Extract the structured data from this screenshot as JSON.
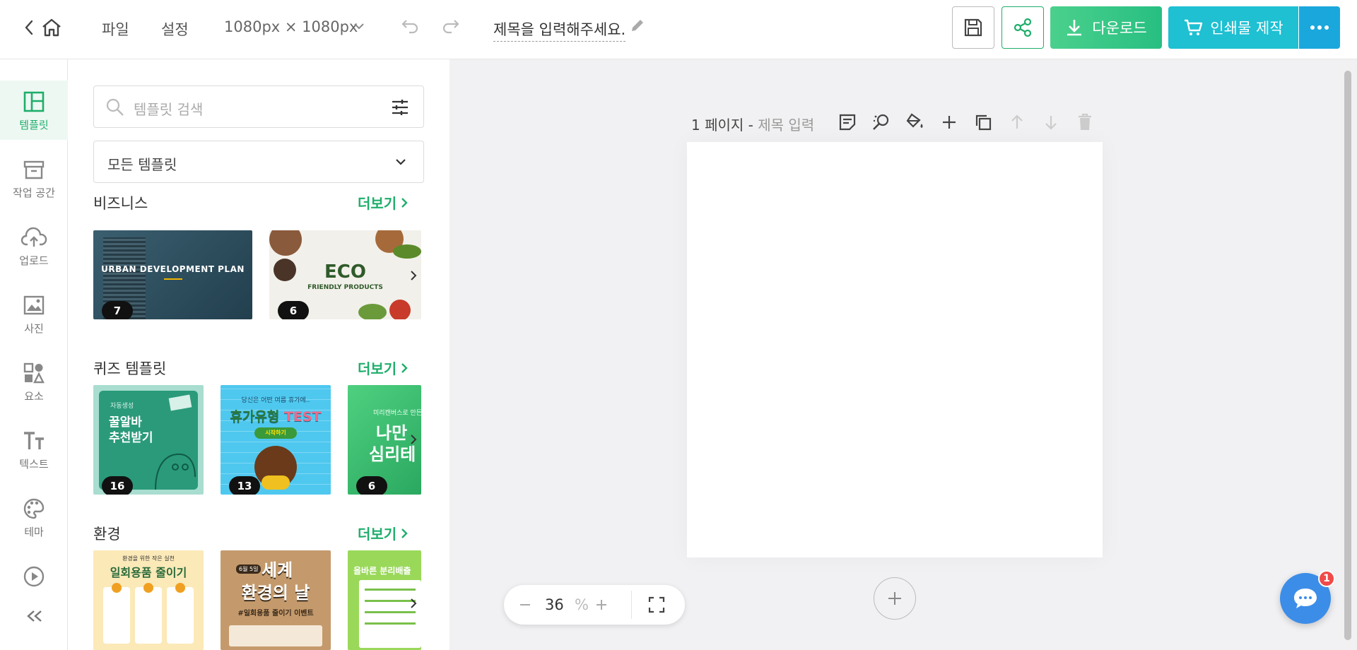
{
  "header": {
    "menu": {
      "file": "파일",
      "settings": "설정"
    },
    "size": "1080px × 1080px",
    "doc_title": "제목을 입력해주세요.",
    "download_label": "다운로드",
    "print_label": "인쇄물 제작"
  },
  "sidebar": {
    "items": [
      {
        "label": "템플릿",
        "icon": "template-icon",
        "active": true
      },
      {
        "label": "작업 공간",
        "icon": "workspace-icon"
      },
      {
        "label": "업로드",
        "icon": "upload-icon"
      },
      {
        "label": "사진",
        "icon": "photo-icon"
      },
      {
        "label": "요소",
        "icon": "elements-icon"
      },
      {
        "label": "텍스트",
        "icon": "text-icon"
      },
      {
        "label": "테마",
        "icon": "theme-icon"
      },
      {
        "label": "",
        "icon": "video-icon"
      }
    ]
  },
  "panel": {
    "search_placeholder": "템플릿 검색",
    "filter_value": "모든 템플릿",
    "more_label": "더보기",
    "sections": [
      {
        "title": "비즈니스",
        "cards": [
          {
            "count": "7",
            "text": "URBAN DEVELOPMENT PLAN"
          },
          {
            "count": "6",
            "text": "ECO",
            "sub": "FRIENDLY PRODUCTS"
          }
        ]
      },
      {
        "title": "퀴즈 템플릿",
        "cards": [
          {
            "count": "16",
            "small": "자동생성",
            "line1": "꿀알바",
            "line2": "추천받기"
          },
          {
            "count": "13",
            "small": "당신은 어떤 여름 휴가에..",
            "line1": "휴가유형",
            "accent": "TEST",
            "btn": "시작하기"
          },
          {
            "count": "6",
            "small": "미리캔버스로 만든",
            "line1": "나만",
            "line2": "심리테"
          }
        ]
      },
      {
        "title": "환경",
        "cards": [
          {
            "small": "환경을 위한 작은 실천",
            "line1": "일회용품 줄이기"
          },
          {
            "small": "6월 5일",
            "line1": "세계",
            "line2": "환경의 날",
            "tag": "#일회용품 줄이기 이벤트"
          },
          {
            "line1": "올바른 분리배출"
          }
        ]
      }
    ]
  },
  "canvas": {
    "page_label": "1 페이지 - ",
    "page_title_placeholder": "제목 입력",
    "zoom_value": "36",
    "zoom_unit": "%"
  },
  "chat": {
    "badge": "1"
  },
  "colors": {
    "brand_green": "#1fae6b",
    "print_teal": "#1ec0d2",
    "chat_blue": "#3c8de8"
  }
}
